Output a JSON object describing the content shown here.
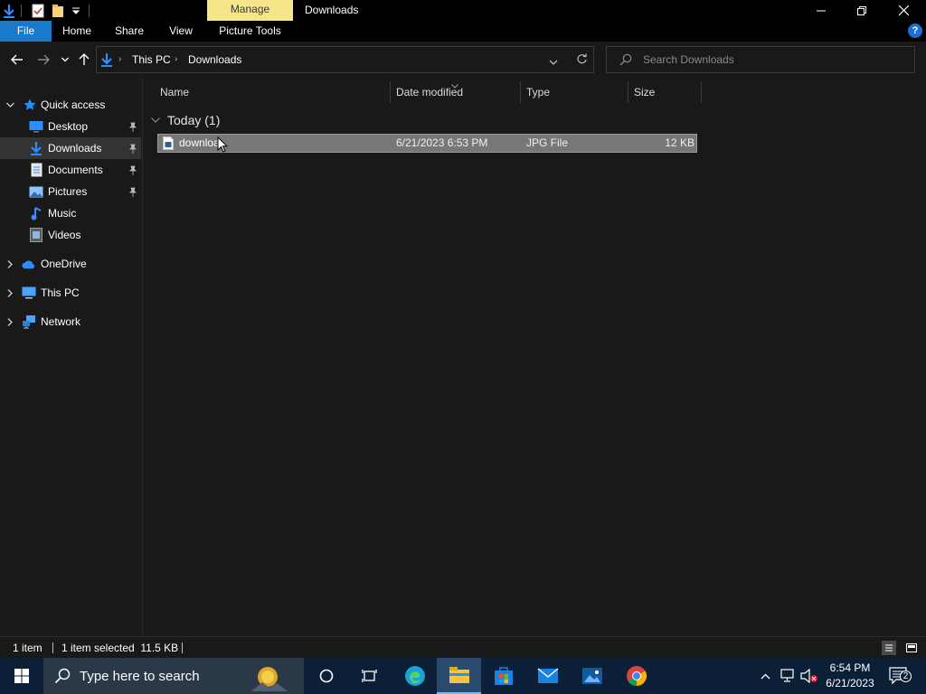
{
  "window": {
    "title": "Downloads",
    "contextual_tab": "Manage"
  },
  "ribbon": {
    "tabs": [
      {
        "label": "File"
      },
      {
        "label": "Home"
      },
      {
        "label": "Share"
      },
      {
        "label": "View"
      },
      {
        "label": "Picture Tools"
      }
    ],
    "help": "?"
  },
  "address": {
    "crumbs": [
      "This PC",
      "Downloads"
    ],
    "search_placeholder": "Search Downloads"
  },
  "nav": {
    "items": [
      {
        "label": "Quick access",
        "icon": "star-icon",
        "color": "#1e90ff"
      },
      {
        "label": "Desktop",
        "icon": "desktop-icon",
        "color": "#2f8cff",
        "pinned": true
      },
      {
        "label": "Downloads",
        "icon": "downloads-icon",
        "color": "#2f8cff",
        "pinned": true,
        "selected": true
      },
      {
        "label": "Documents",
        "icon": "documents-icon",
        "color": "#cfcfcf",
        "pinned": true
      },
      {
        "label": "Pictures",
        "icon": "pictures-icon",
        "color": "#6fb3ff",
        "pinned": true
      },
      {
        "label": "Music",
        "icon": "music-icon",
        "color": "#3d8bff"
      },
      {
        "label": "Videos",
        "icon": "videos-icon",
        "color": "#9a9a9a"
      },
      {
        "label": "OneDrive",
        "icon": "onedrive-icon",
        "color": "#2f8cff"
      },
      {
        "label": "This PC",
        "icon": "this-pc-icon",
        "color": "#4aa3ff"
      },
      {
        "label": "Network",
        "icon": "network-icon",
        "color": "#4aa3ff"
      }
    ]
  },
  "columns": {
    "name": "Name",
    "date": "Date modified",
    "type": "Type",
    "size": "Size"
  },
  "group": {
    "label": "Today (1)"
  },
  "files": [
    {
      "name": "downloa",
      "date": "6/21/2023 6:53 PM",
      "type": "JPG File",
      "size": "12 KB"
    }
  ],
  "status": {
    "count": "1 item",
    "selected": "1 item selected  11.5 KB"
  },
  "taskbar": {
    "search_placeholder": "Type here to search",
    "time": "6:54 PM",
    "date": "6/21/2023",
    "notifications": "2"
  },
  "colors": {
    "accent": "#1979ca",
    "manage_tab": "#f6e68a",
    "taskbar": "#0b1f36"
  }
}
